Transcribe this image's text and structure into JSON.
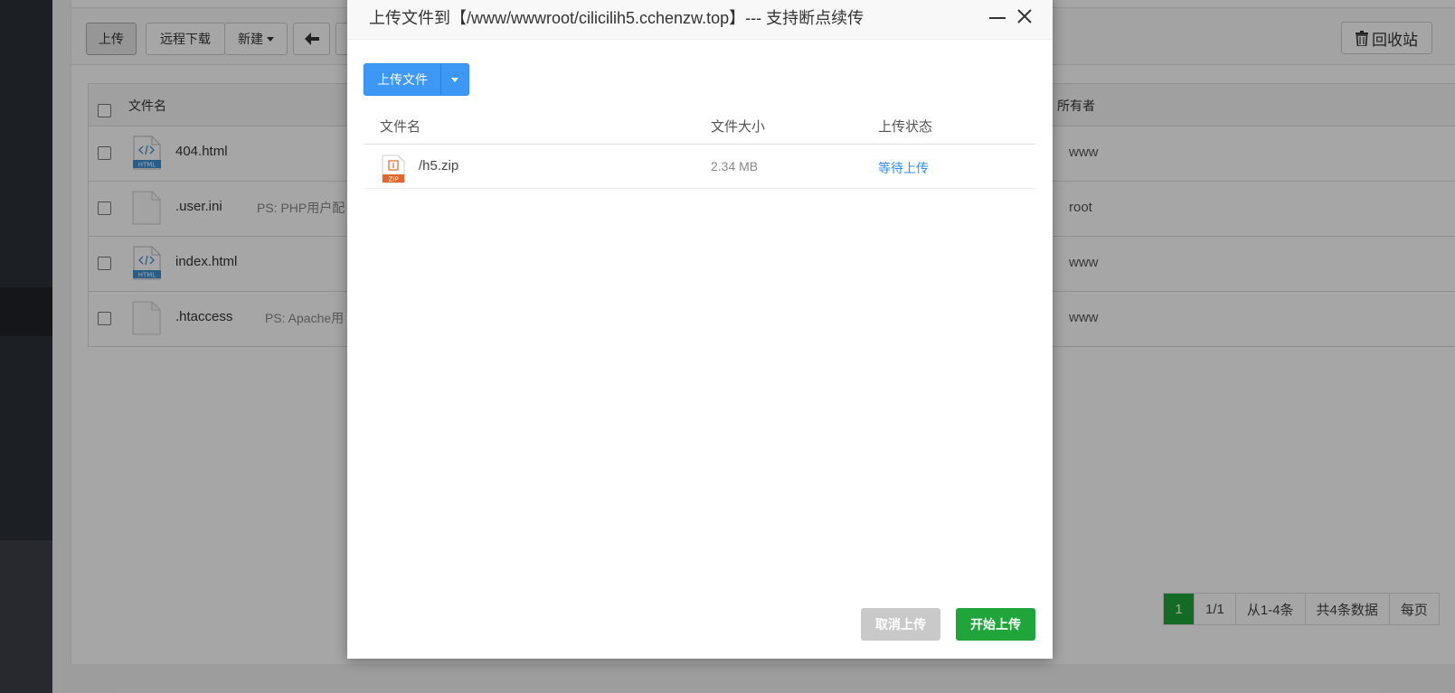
{
  "toolbar": {
    "upload": "上传",
    "remote_download": "远程下载",
    "new": "新建",
    "recycle_bin": "回收站"
  },
  "file_table": {
    "headers": {
      "name": "文件名",
      "owner": "所有者"
    },
    "rows": [
      {
        "name": "404.html",
        "ps": "",
        "owner": "www",
        "icon": "html-file-icon"
      },
      {
        "name": ".user.ini",
        "ps": "PS: PHP用户配",
        "owner": "root",
        "icon": "blank-file-icon"
      },
      {
        "name": "index.html",
        "ps": "",
        "owner": "www",
        "icon": "html-file-icon"
      },
      {
        "name": ".htaccess",
        "ps": "PS: Apache用",
        "owner": "www",
        "icon": "blank-file-icon"
      }
    ]
  },
  "pager": {
    "current": "1",
    "pages": "1/1",
    "range": "从1-4条",
    "total": "共4条数据",
    "per_page": "每页"
  },
  "dialog": {
    "title": "上传文件到【/www/wwwroot/cilicilih5.cchenzw.top】--- 支持断点续传",
    "upload_button": "上传文件",
    "headers": {
      "name": "文件名",
      "size": "文件大小",
      "status": "上传状态"
    },
    "files": [
      {
        "name": "/h5.zip",
        "size": "2.34 MB",
        "status": "等待上传"
      }
    ],
    "cancel": "取消上传",
    "start": "开始上传"
  },
  "colors": {
    "primary_blue": "#3d97f5",
    "success_green": "#20a53a",
    "link_blue": "#2e8ded"
  }
}
